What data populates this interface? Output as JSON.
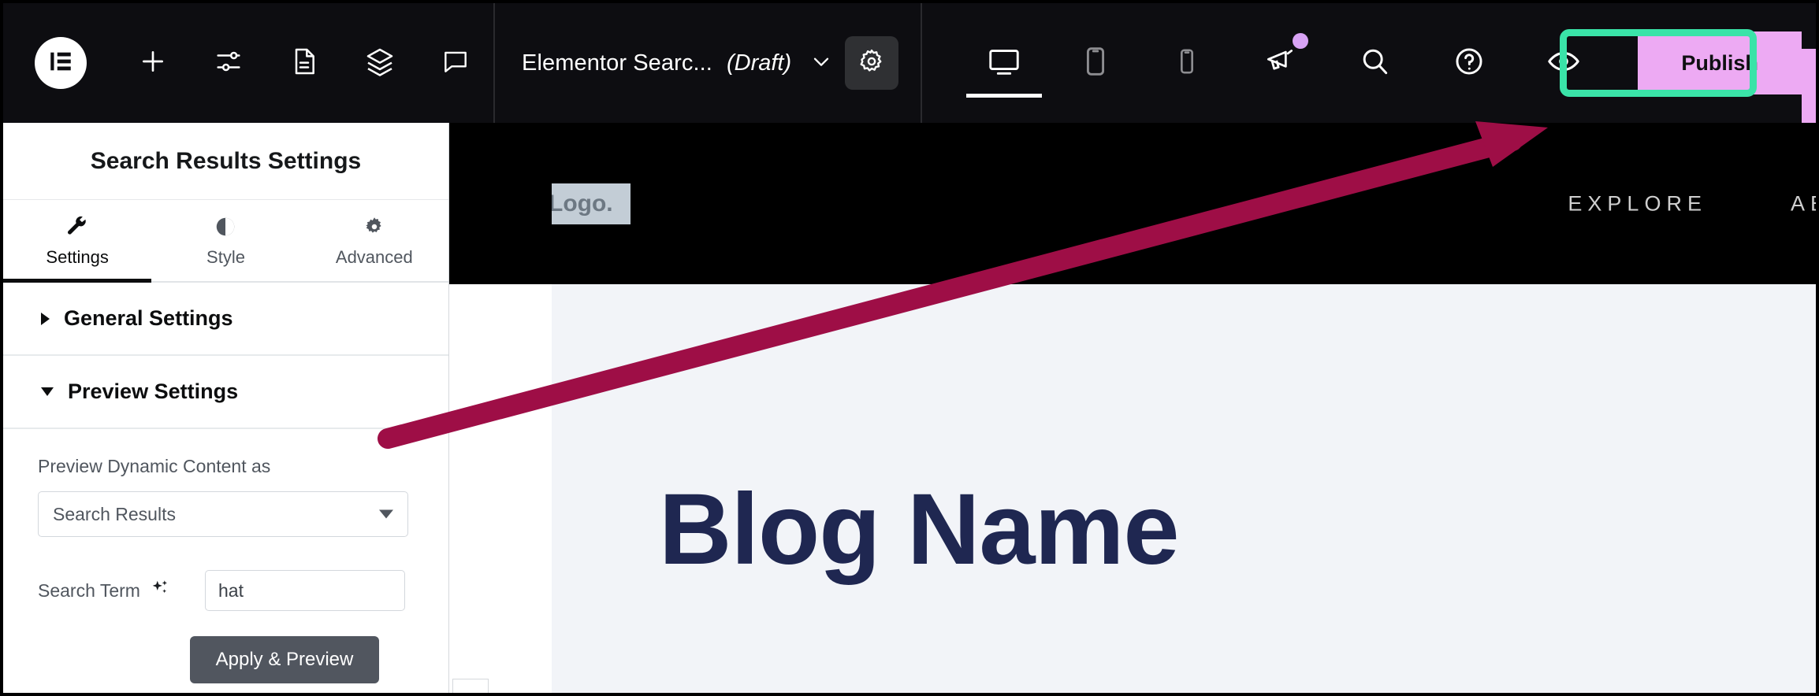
{
  "topbar": {
    "logo_icon": "elementor-logo-icon",
    "tools": [
      {
        "name": "add-element-button",
        "icon": "plus-icon"
      },
      {
        "name": "site-settings-button",
        "icon": "sliders-icon"
      },
      {
        "name": "page-settings-button",
        "icon": "document-icon"
      },
      {
        "name": "structure-button",
        "icon": "layers-icon"
      },
      {
        "name": "notes-button",
        "icon": "comment-icon"
      }
    ],
    "document": {
      "title": "Elementor Searc...",
      "status": "(Draft)",
      "caret_icon": "chevron-down-icon",
      "settings_icon": "gear-icon"
    },
    "devices": [
      {
        "name": "desktop",
        "icon": "desktop-icon",
        "active": true
      },
      {
        "name": "tablet",
        "icon": "tablet-icon",
        "active": false
      },
      {
        "name": "mobile",
        "icon": "mobile-icon",
        "active": false
      }
    ],
    "right_icons": [
      {
        "name": "whats-new-button",
        "icon": "megaphone-icon",
        "badge": true
      },
      {
        "name": "finder-button",
        "icon": "search-icon",
        "badge": false
      },
      {
        "name": "help-button",
        "icon": "question-circle-icon",
        "badge": false
      },
      {
        "name": "preview-changes-button",
        "icon": "eye-icon",
        "badge": false
      }
    ],
    "publish": {
      "label": "Publish",
      "caret_icon": "chevron-down-icon",
      "button_color": "#edaaf3",
      "highlight_color": "#3ae3a8"
    }
  },
  "panel": {
    "title": "Search Results Settings",
    "tabs": [
      {
        "label": "Settings",
        "icon": "wrench-icon",
        "active": true
      },
      {
        "label": "Style",
        "icon": "contrast-icon",
        "active": false
      },
      {
        "label": "Advanced",
        "icon": "gear-icon",
        "active": false
      }
    ],
    "sections": [
      {
        "label": "General Settings",
        "expanded": false
      },
      {
        "label": "Preview Settings",
        "expanded": true
      }
    ],
    "preview_settings": {
      "dynamic_content_label": "Preview Dynamic Content as",
      "dynamic_content_value": "Search Results",
      "search_term_label": "Search Term",
      "search_term_icon": "ai-sparkle-icon",
      "search_term_value": "hat",
      "apply_button": "Apply & Preview"
    }
  },
  "canvas": {
    "logo_text": "Logo.",
    "nav": [
      {
        "label": "EXPLORE"
      },
      {
        "label": "AB"
      }
    ],
    "blog_title": "Blog Name"
  },
  "annotation": {
    "arrow_color": "#9e0e46",
    "target": "publish-button"
  }
}
